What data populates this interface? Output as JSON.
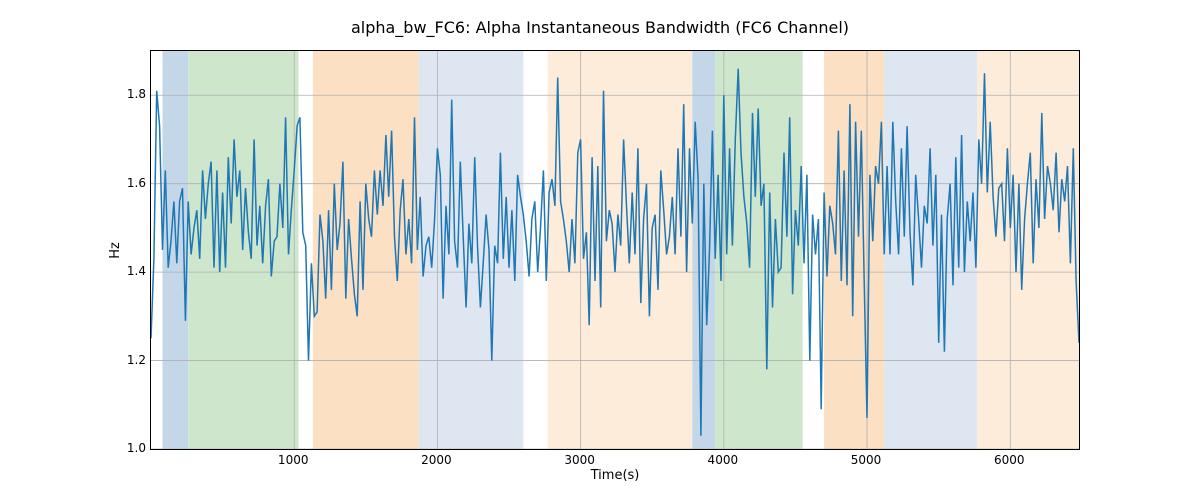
{
  "chart_data": {
    "type": "line",
    "title": "alpha_bw_FC6: Alpha Instantaneous Bandwidth (FC6 Channel)",
    "xlabel": "Time(s)",
    "ylabel": "Hz",
    "xlim": [
      0,
      6480
    ],
    "ylim": [
      1.0,
      1.9
    ],
    "xticks": [
      1000,
      2000,
      3000,
      4000,
      5000,
      6000
    ],
    "yticks": [
      1.0,
      1.2,
      1.4,
      1.6,
      1.8
    ],
    "grid": true,
    "bands": [
      {
        "x0": 80,
        "x1": 260,
        "color": "blue"
      },
      {
        "x0": 260,
        "x1": 1030,
        "color": "green"
      },
      {
        "x0": 1130,
        "x1": 1870,
        "color": "orange"
      },
      {
        "x0": 1870,
        "x1": 2600,
        "color": "lblue"
      },
      {
        "x0": 2770,
        "x1": 3780,
        "color": "lorange"
      },
      {
        "x0": 3780,
        "x1": 3940,
        "color": "blue"
      },
      {
        "x0": 3940,
        "x1": 4550,
        "color": "green"
      },
      {
        "x0": 4700,
        "x1": 5120,
        "color": "orange"
      },
      {
        "x0": 5120,
        "x1": 5770,
        "color": "lblue"
      },
      {
        "x0": 5770,
        "x1": 6480,
        "color": "lorange"
      }
    ],
    "x": [
      0,
      20,
      40,
      60,
      80,
      100,
      120,
      140,
      160,
      180,
      200,
      220,
      240,
      260,
      280,
      300,
      320,
      340,
      360,
      380,
      400,
      420,
      440,
      460,
      480,
      500,
      520,
      540,
      560,
      580,
      600,
      620,
      640,
      660,
      680,
      700,
      720,
      740,
      760,
      780,
      800,
      820,
      840,
      860,
      880,
      900,
      920,
      940,
      960,
      980,
      1000,
      1020,
      1040,
      1060,
      1080,
      1100,
      1120,
      1140,
      1160,
      1180,
      1200,
      1220,
      1240,
      1260,
      1280,
      1300,
      1320,
      1340,
      1360,
      1380,
      1400,
      1420,
      1440,
      1460,
      1480,
      1500,
      1520,
      1540,
      1560,
      1580,
      1600,
      1620,
      1640,
      1660,
      1680,
      1700,
      1720,
      1740,
      1760,
      1780,
      1800,
      1820,
      1840,
      1860,
      1880,
      1900,
      1920,
      1940,
      1960,
      1980,
      2000,
      2020,
      2040,
      2060,
      2080,
      2100,
      2120,
      2140,
      2160,
      2180,
      2200,
      2220,
      2240,
      2260,
      2280,
      2300,
      2320,
      2340,
      2360,
      2380,
      2400,
      2420,
      2440,
      2460,
      2480,
      2500,
      2520,
      2540,
      2560,
      2580,
      2600,
      2620,
      2640,
      2660,
      2680,
      2700,
      2720,
      2740,
      2760,
      2780,
      2800,
      2820,
      2840,
      2860,
      2880,
      2900,
      2920,
      2940,
      2960,
      2980,
      3000,
      3020,
      3040,
      3060,
      3080,
      3100,
      3120,
      3140,
      3160,
      3180,
      3200,
      3220,
      3240,
      3260,
      3280,
      3300,
      3320,
      3340,
      3360,
      3380,
      3400,
      3420,
      3440,
      3460,
      3480,
      3500,
      3520,
      3540,
      3560,
      3580,
      3600,
      3620,
      3640,
      3660,
      3680,
      3700,
      3720,
      3740,
      3760,
      3780,
      3800,
      3820,
      3840,
      3860,
      3880,
      3900,
      3920,
      3940,
      3960,
      3980,
      4000,
      4020,
      4040,
      4060,
      4080,
      4100,
      4120,
      4140,
      4160,
      4180,
      4200,
      4220,
      4240,
      4260,
      4280,
      4300,
      4320,
      4340,
      4360,
      4380,
      4400,
      4420,
      4440,
      4460,
      4480,
      4500,
      4520,
      4540,
      4560,
      4580,
      4600,
      4620,
      4640,
      4660,
      4680,
      4700,
      4720,
      4740,
      4760,
      4780,
      4800,
      4820,
      4840,
      4860,
      4880,
      4900,
      4920,
      4940,
      4960,
      4980,
      5000,
      5020,
      5040,
      5060,
      5080,
      5100,
      5120,
      5140,
      5160,
      5180,
      5200,
      5220,
      5240,
      5260,
      5280,
      5300,
      5320,
      5340,
      5360,
      5380,
      5400,
      5420,
      5440,
      5460,
      5480,
      5500,
      5520,
      5540,
      5560,
      5580,
      5600,
      5620,
      5640,
      5660,
      5680,
      5700,
      5720,
      5740,
      5760,
      5780,
      5800,
      5820,
      5840,
      5860,
      5880,
      5900,
      5920,
      5940,
      5960,
      5980,
      6000,
      6020,
      6040,
      6060,
      6080,
      6100,
      6120,
      6140,
      6160,
      6180,
      6200,
      6220,
      6240,
      6260,
      6280,
      6300,
      6320,
      6340,
      6360,
      6380,
      6400,
      6420,
      6440,
      6460,
      6480
    ],
    "values": [
      1.25,
      1.43,
      1.81,
      1.73,
      1.45,
      1.63,
      1.41,
      1.47,
      1.56,
      1.42,
      1.56,
      1.59,
      1.29,
      1.56,
      1.44,
      1.5,
      1.54,
      1.43,
      1.63,
      1.52,
      1.6,
      1.65,
      1.41,
      1.63,
      1.4,
      1.58,
      1.41,
      1.66,
      1.51,
      1.7,
      1.57,
      1.63,
      1.45,
      1.59,
      1.49,
      1.43,
      1.7,
      1.46,
      1.55,
      1.42,
      1.55,
      1.61,
      1.39,
      1.47,
      1.48,
      1.6,
      1.5,
      1.75,
      1.44,
      1.54,
      1.63,
      1.73,
      1.75,
      1.49,
      1.46,
      1.2,
      1.42,
      1.3,
      1.31,
      1.53,
      1.47,
      1.34,
      1.54,
      1.36,
      1.6,
      1.45,
      1.51,
      1.65,
      1.34,
      1.52,
      1.43,
      1.35,
      1.3,
      1.56,
      1.36,
      1.6,
      1.52,
      1.48,
      1.63,
      1.53,
      1.63,
      1.55,
      1.71,
      1.57,
      1.72,
      1.48,
      1.38,
      1.54,
      1.61,
      1.44,
      1.52,
      1.42,
      1.75,
      1.45,
      1.57,
      1.39,
      1.46,
      1.48,
      1.41,
      1.52,
      1.68,
      1.62,
      1.34,
      1.55,
      1.44,
      1.79,
      1.47,
      1.41,
      1.65,
      1.48,
      1.32,
      1.51,
      1.42,
      1.66,
      1.46,
      1.32,
      1.42,
      1.53,
      1.45,
      1.2,
      1.46,
      1.42,
      1.67,
      1.43,
      1.57,
      1.41,
      1.54,
      1.38,
      1.62,
      1.57,
      1.53,
      1.47,
      1.39,
      1.52,
      1.56,
      1.4,
      1.5,
      1.63,
      1.38,
      1.58,
      1.61,
      1.55,
      1.84,
      1.56,
      1.52,
      1.47,
      1.4,
      1.52,
      1.42,
      1.67,
      1.7,
      1.43,
      1.49,
      1.28,
      1.66,
      1.38,
      1.64,
      1.32,
      1.81,
      1.47,
      1.54,
      1.51,
      1.4,
      1.53,
      1.46,
      1.7,
      1.55,
      1.42,
      1.58,
      1.44,
      1.68,
      1.33,
      1.52,
      1.6,
      1.3,
      1.5,
      1.53,
      1.36,
      1.63,
      1.54,
      1.44,
      1.48,
      1.57,
      1.44,
      1.68,
      1.48,
      1.78,
      1.4,
      1.68,
      1.51,
      1.74,
      1.61,
      1.03,
      1.6,
      1.28,
      1.45,
      1.72,
      1.43,
      1.62,
      1.38,
      1.8,
      1.44,
      1.68,
      1.46,
      1.7,
      1.86,
      1.67,
      1.57,
      1.51,
      1.41,
      1.76,
      1.57,
      1.77,
      1.55,
      1.6,
      1.18,
      1.58,
      1.32,
      1.52,
      1.4,
      1.41,
      1.67,
      1.48,
      1.75,
      1.35,
      1.54,
      1.46,
      1.64,
      1.42,
      1.62,
      1.2,
      1.53,
      1.44,
      1.52,
      1.09,
      1.58,
      1.39,
      1.55,
      1.51,
      1.44,
      1.72,
      1.38,
      1.63,
      1.37,
      1.78,
      1.3,
      1.74,
      1.48,
      1.72,
      1.38,
      1.07,
      1.62,
      1.47,
      1.64,
      1.6,
      1.74,
      1.44,
      1.64,
      1.44,
      1.74,
      1.56,
      1.44,
      1.68,
      1.48,
      1.73,
      1.49,
      1.37,
      1.62,
      1.52,
      1.41,
      1.55,
      1.51,
      1.68,
      1.46,
      1.62,
      1.24,
      1.53,
      1.22,
      1.52,
      1.6,
      1.37,
      1.66,
      1.41,
      1.71,
      1.4,
      1.56,
      1.47,
      1.58,
      1.41,
      1.7,
      1.6,
      1.85,
      1.58,
      1.74,
      1.57,
      1.48,
      1.59,
      1.6,
      1.47,
      1.68,
      1.5,
      1.62,
      1.4,
      1.6,
      1.36,
      1.52,
      1.6,
      1.67,
      1.42,
      1.61,
      1.5,
      1.76,
      1.52,
      1.64,
      1.6,
      1.54,
      1.67,
      1.49,
      1.61,
      1.56,
      1.64,
      1.42,
      1.68,
      1.38,
      1.24
    ]
  }
}
